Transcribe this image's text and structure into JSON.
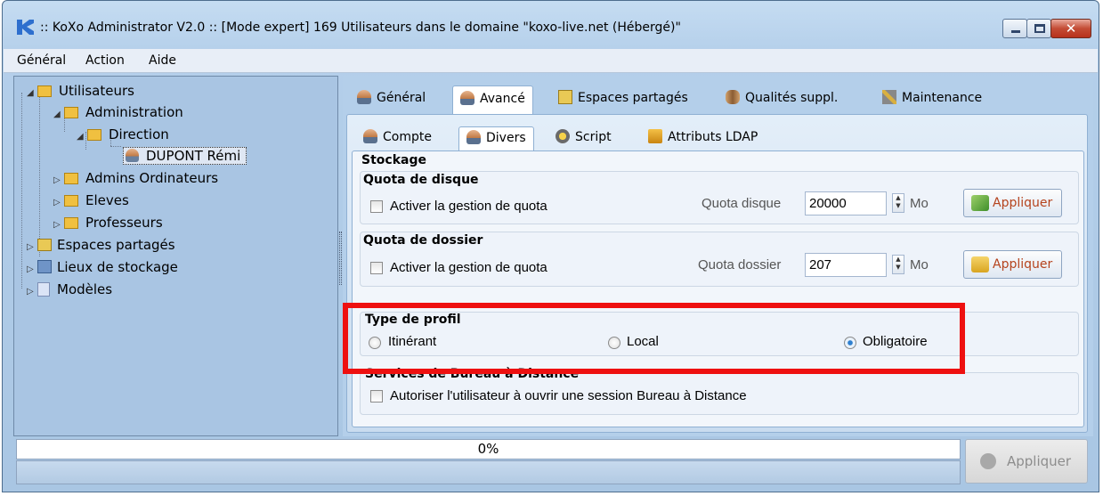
{
  "window": {
    "title": ":: KoXo Administrator V2.0 :: [Mode expert] 169 Utilisateurs dans le domaine \"koxo-live.net (Hébergé)\""
  },
  "menu": {
    "general": "Général",
    "action": "Action",
    "aide": "Aide"
  },
  "tree": {
    "utilisateurs": "Utilisateurs",
    "administration": "Administration",
    "direction": "Direction",
    "selected_user": "DUPONT Rémi",
    "admins_ordinateurs": "Admins Ordinateurs",
    "eleves": "Eleves",
    "professeurs": "Professeurs",
    "espaces_partages": "Espaces partagés",
    "lieux_stockage": "Lieux de stockage",
    "modeles": "Modèles"
  },
  "tabs_main": [
    "Général",
    "Avancé",
    "Espaces partagés",
    "Qualités suppl.",
    "Maintenance"
  ],
  "tabs_sub": [
    "Compte",
    "Divers",
    "Script",
    "Attributs LDAP"
  ],
  "stockage": {
    "title": "Stockage",
    "quota_disque": {
      "title": "Quota de disque",
      "checkbox_label": "Activer la gestion de quota",
      "field_label": "Quota disque",
      "value": "20000",
      "unit": "Mo",
      "apply": "Appliquer"
    },
    "quota_dossier": {
      "title": "Quota de dossier",
      "checkbox_label": "Activer la gestion de quota",
      "field_label": "Quota dossier",
      "value": "207",
      "unit": "Mo",
      "apply": "Appliquer"
    }
  },
  "profil": {
    "title": "Type de profil",
    "options": [
      "Itinérant",
      "Local",
      "Obligatoire"
    ],
    "selected": "Obligatoire"
  },
  "rds": {
    "title": "Services de Bureau à Distance",
    "checkbox_label": "Autoriser l'utilisateur à ouvrir une session Bureau à Distance"
  },
  "footer": {
    "progress": "0%",
    "progress_value": 0,
    "apply": "Appliquer"
  },
  "colors": {
    "highlight": "#ee1010",
    "apply_text": "#b5431d"
  }
}
